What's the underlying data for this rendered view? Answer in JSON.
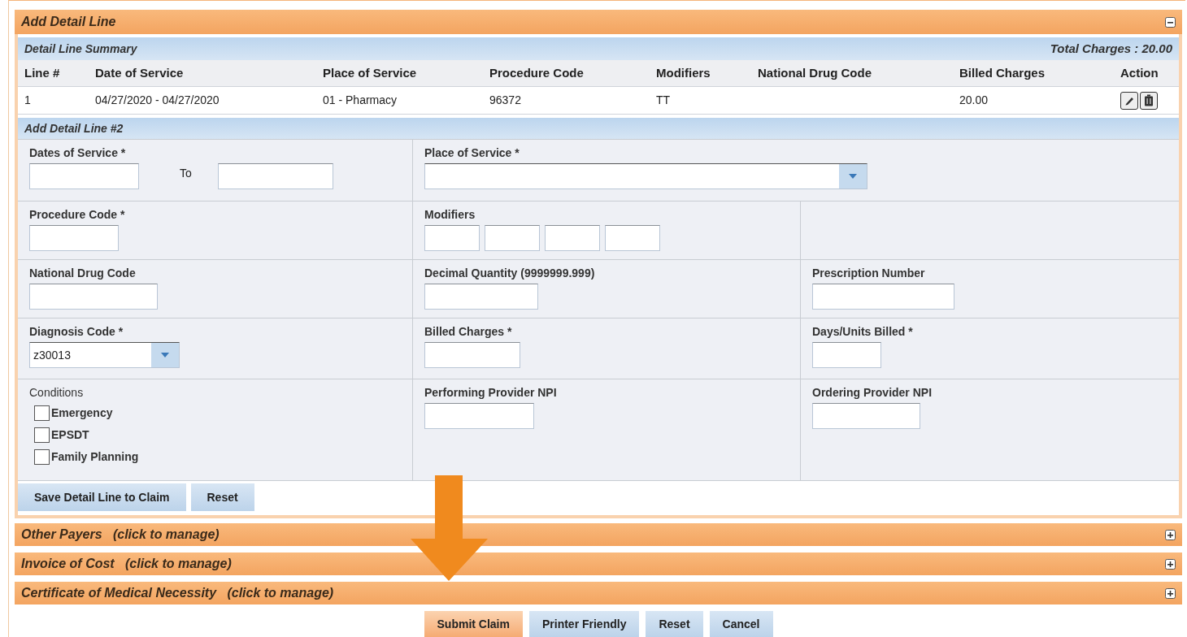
{
  "panel": {
    "title": "Add Detail Line",
    "expanded": true
  },
  "summary": {
    "title": "Detail Line Summary",
    "total": "Total Charges : 20.00",
    "columns": [
      "Line #",
      "Date of Service",
      "Place of Service",
      "Procedure Code",
      "Modifiers",
      "National Drug Code",
      "Billed Charges",
      "Action"
    ],
    "rows": [
      {
        "cells": [
          "1",
          "04/27/2020 - 04/27/2020",
          "01 - Pharmacy",
          "96372",
          "TT",
          "",
          "20.00"
        ]
      }
    ]
  },
  "form": {
    "title": "Add Detail Line #2",
    "rows": [
      {
        "cells": [
          {
            "kind": "date_range",
            "label": "Dates of Service *",
            "to_label": "To"
          },
          {
            "kind": "select",
            "label": "Place of Service  *"
          }
        ]
      },
      {
        "cells": [
          {
            "kind": "text",
            "label": "Procedure Code *"
          },
          {
            "kind": "modifiers",
            "label": "Modifiers"
          },
          {
            "kind": "empty"
          }
        ]
      },
      {
        "cells": [
          {
            "kind": "text",
            "label": "National Drug Code"
          },
          {
            "kind": "text",
            "label": "Decimal Quantity (9999999.999)"
          },
          {
            "kind": "text",
            "label": "Prescription Number"
          }
        ]
      },
      {
        "cells": [
          {
            "kind": "combo",
            "label": "Diagnosis Code  *",
            "value": "z30013"
          },
          {
            "kind": "text",
            "label": "Billed Charges  *"
          },
          {
            "kind": "text",
            "label": "Days/Units Billed  *"
          }
        ]
      },
      {
        "cells": [
          {
            "kind": "checkboxes",
            "label": "Conditions",
            "options": [
              {
                "label": "Emergency",
                "checked": false
              },
              {
                "label": "EPSDT",
                "checked": false
              },
              {
                "label": "Family Planning",
                "checked": false
              }
            ]
          },
          {
            "kind": "text",
            "label": "Performing Provider NPI"
          },
          {
            "kind": "text",
            "label": "Ordering Provider NPI"
          }
        ]
      }
    ],
    "buttons": [
      "Save Detail Line to Claim",
      "Reset"
    ]
  },
  "sections": [
    {
      "title": "Other Payers",
      "hint": "(click to manage)",
      "expanded": false
    },
    {
      "title": "Invoice of Cost",
      "hint": "(click to manage)",
      "expanded": false
    },
    {
      "title": "Certificate of Medical Necessity",
      "hint": "(click to manage)",
      "expanded": false
    }
  ],
  "actions": [
    {
      "label": "Submit Claim",
      "kind": "primary"
    },
    {
      "label": "Printer Friendly",
      "kind": "secondary"
    },
    {
      "label": "Reset",
      "kind": "secondary"
    },
    {
      "label": "Cancel",
      "kind": "secondary"
    }
  ]
}
